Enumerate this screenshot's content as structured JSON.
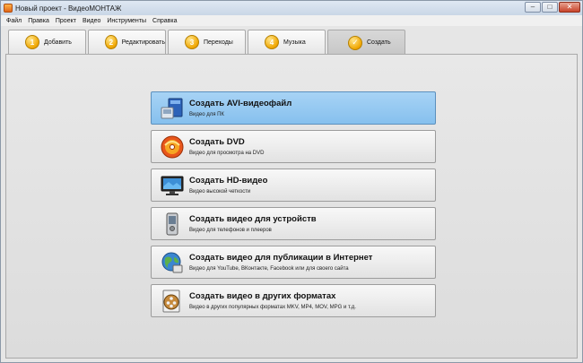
{
  "window": {
    "title": "Новый проект - ВидеоМОНТАЖ"
  },
  "menu": [
    "Файл",
    "Правка",
    "Проект",
    "Видео",
    "Инструменты",
    "Справка"
  ],
  "tabs": [
    {
      "num": "1",
      "label": "Добавить"
    },
    {
      "num": "2",
      "label": "Редактировать"
    },
    {
      "num": "3",
      "label": "Переходы"
    },
    {
      "num": "4",
      "label": "Музыка"
    },
    {
      "num": "",
      "label": "Создать",
      "active": true
    }
  ],
  "options": [
    {
      "title": "Создать AVI-видеофайл",
      "subtitle": "Видео для ПК",
      "icon": "avi-file-icon",
      "selected": true
    },
    {
      "title": "Создать DVD",
      "subtitle": "Видео для просмотра на DVD",
      "icon": "dvd-disc-icon"
    },
    {
      "title": "Создать HD-видео",
      "subtitle": "Видео высокой четкости",
      "icon": "monitor-icon"
    },
    {
      "title": "Создать видео для устройств",
      "subtitle": "Видео для телефонов и плееров",
      "icon": "phone-icon"
    },
    {
      "title": "Создать видео для публикации в Интернет",
      "subtitle": "Видео для YouTube, ВКонтакте, Facebook или для своего сайта",
      "icon": "globe-icon"
    },
    {
      "title": "Создать видео в других форматах",
      "subtitle": "Видео в других популярных форматах MKV, MP4, MOV, MPG и т.д.",
      "icon": "film-reel-icon"
    }
  ],
  "colors": {
    "selected": "#9ccdf3",
    "tab_badge": "#f0a600"
  }
}
